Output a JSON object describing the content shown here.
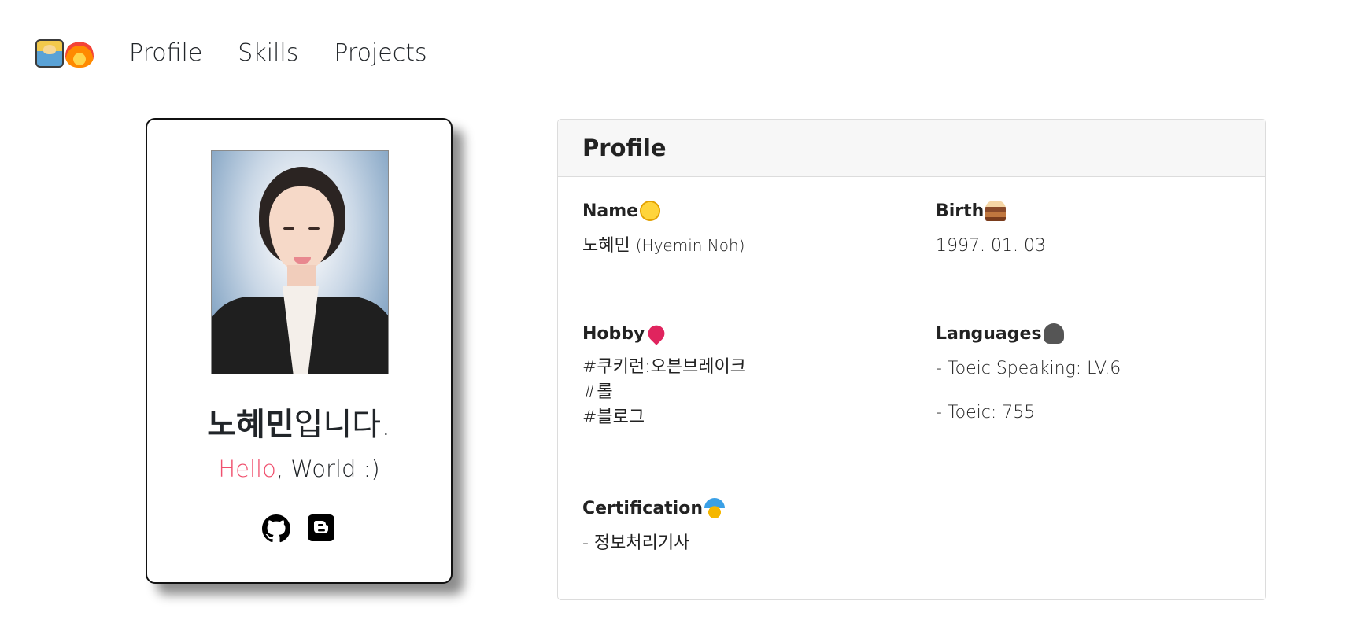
{
  "nav": {
    "brand_icons": [
      "technologist-icon",
      "fire-icon"
    ],
    "links": [
      "Profile",
      "Skills",
      "Projects"
    ]
  },
  "card": {
    "name": "노혜민",
    "name_suffix": "입니다.",
    "greeting_highlight": "Hello",
    "greeting_rest": ", World :)",
    "accent_color": "#f0506e",
    "social_icons": [
      "github-icon",
      "blogger-icon"
    ]
  },
  "profile": {
    "title": "Profile",
    "name": {
      "label": "Name",
      "emoji": "grinning-face-icon",
      "value_kr": "노혜민",
      "value_en": "(Hyemin Noh)"
    },
    "birth": {
      "label": "Birth",
      "emoji": "cake-icon",
      "value": "1997. 01. 03"
    },
    "hobby": {
      "label": "Hobby",
      "emoji": "heart-icon",
      "items": [
        "#쿠키런:오븐브레이크",
        "#롤",
        "#블로그"
      ]
    },
    "languages": {
      "label": "Languages",
      "emoji": "speaking-head-icon",
      "items": [
        "- Toeic Speaking: LV.6",
        "- Toeic: 755"
      ]
    },
    "certification": {
      "label": "Certification",
      "emoji": "medal-icon",
      "items": [
        "- 정보처리기사"
      ]
    }
  }
}
